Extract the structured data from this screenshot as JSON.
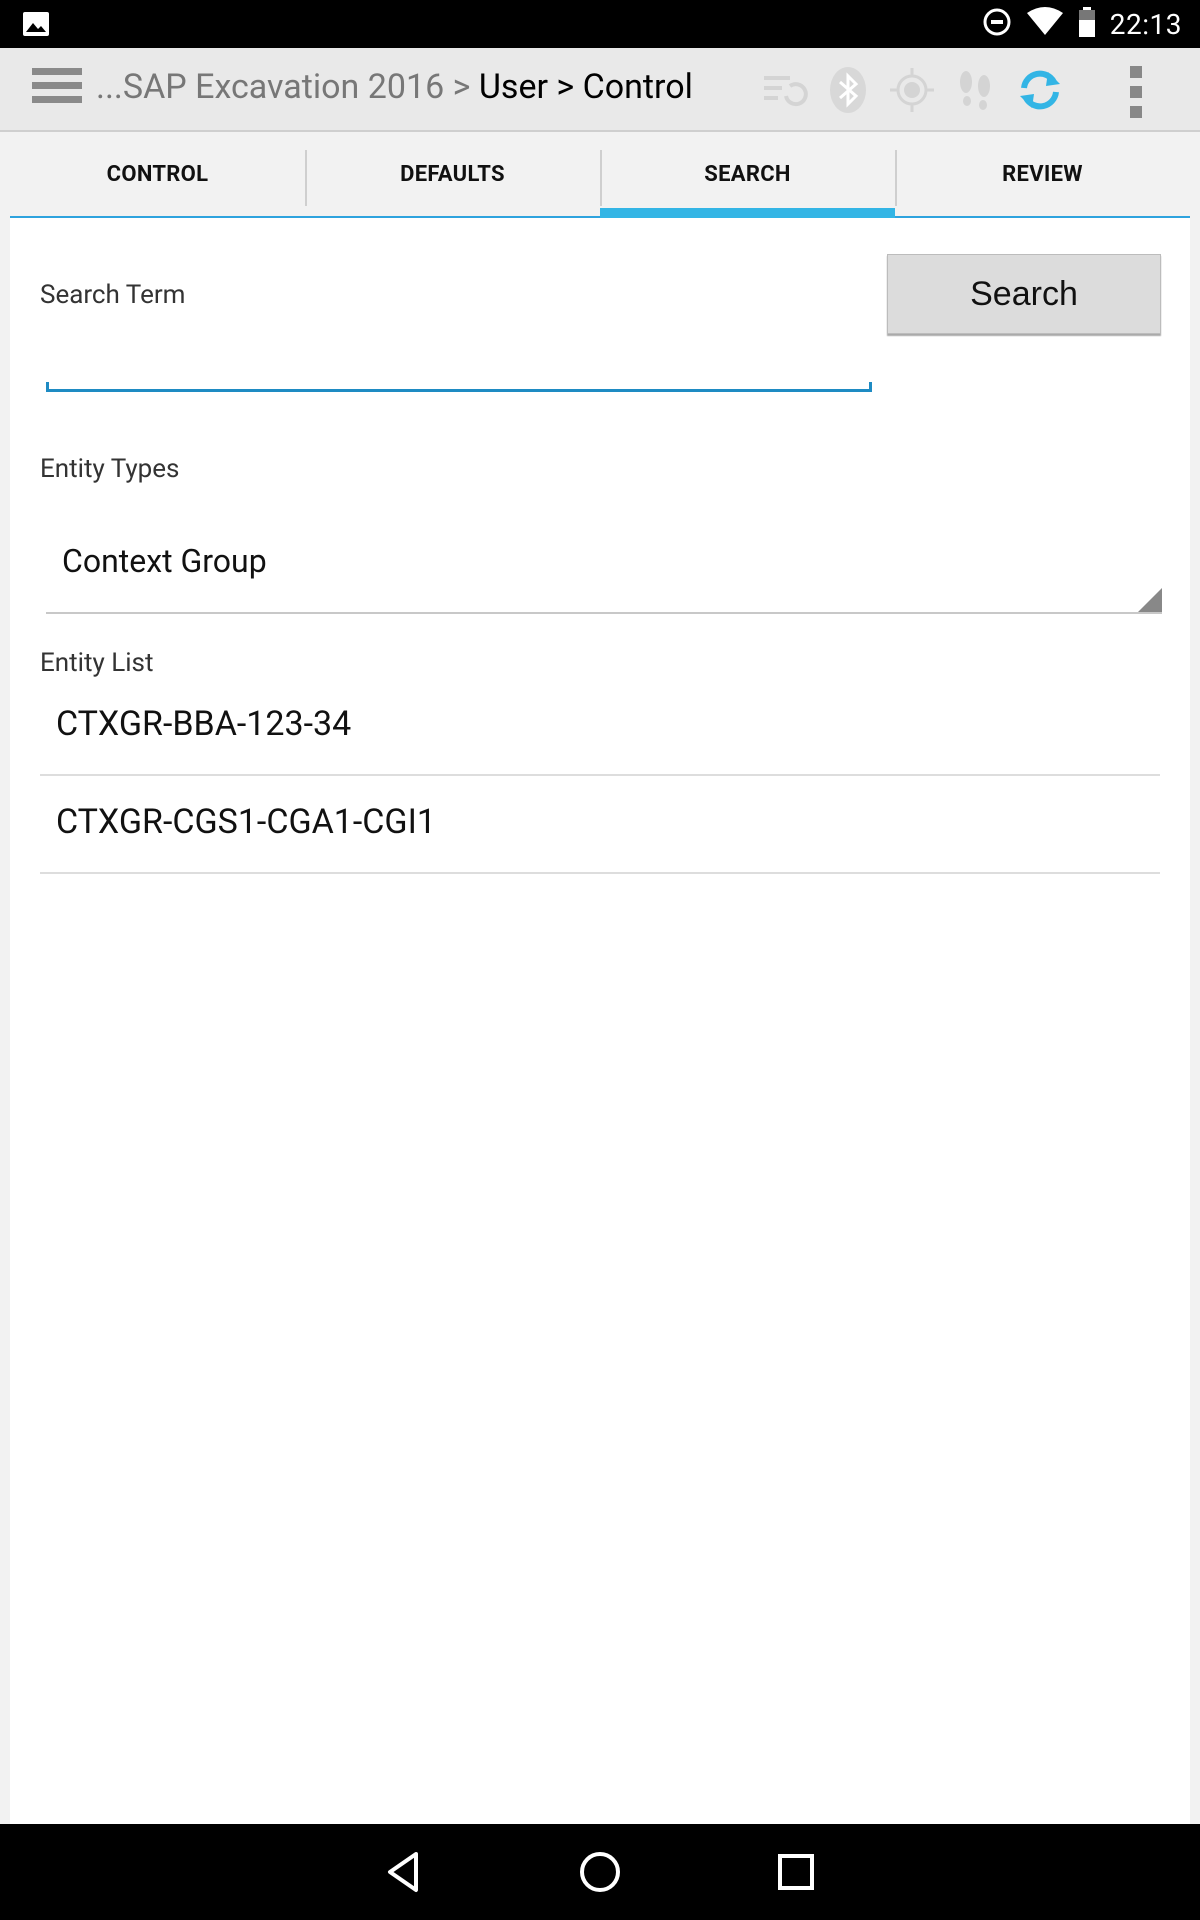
{
  "status_bar": {
    "time": "22:13",
    "icons": [
      "image-notification-icon",
      "do-not-disturb-icon",
      "wifi-icon",
      "battery-icon"
    ]
  },
  "action_bar": {
    "title_prefix": "...SAP Excavation 2016 > ",
    "title_main": "User > Control",
    "icons": [
      "menu-icon",
      "sync-list-icon",
      "bluetooth-icon",
      "gps-target-icon",
      "footsteps-icon",
      "refresh-icon",
      "overflow-menu-icon"
    ],
    "accent": "#33b5e5"
  },
  "tabs": [
    {
      "label": "CONTROL",
      "active": false
    },
    {
      "label": "DEFAULTS",
      "active": false
    },
    {
      "label": "SEARCH",
      "active": true
    },
    {
      "label": "REVIEW",
      "active": false
    }
  ],
  "search": {
    "term_label": "Search Term",
    "term_value": "",
    "button_label": "Search",
    "entity_types_label": "Entity Types",
    "entity_type_selected": "Context Group",
    "entity_list_label": "Entity List",
    "entity_list": [
      "CTXGR-BBA-123-34",
      "CTXGR-CGS1-CGA1-CGI1"
    ]
  },
  "nav_bar": {
    "icons": [
      "back-icon",
      "home-icon",
      "recents-icon"
    ]
  }
}
